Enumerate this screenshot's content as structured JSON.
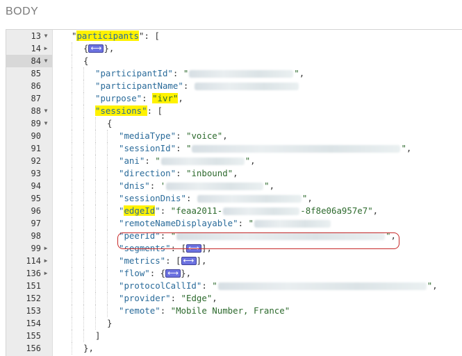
{
  "section_title": "BODY",
  "editor": {
    "lines": [
      {
        "n": "13",
        "fold": "down",
        "indent": 1,
        "parts": [
          {
            "t": "\"",
            "c": "p"
          },
          {
            "t": "participants",
            "c": "k",
            "hl": true
          },
          {
            "t": "\": [",
            "c": "p"
          }
        ]
      },
      {
        "n": "14",
        "fold": "right",
        "indent": 2,
        "parts": [
          {
            "t": "{",
            "c": "p"
          },
          {
            "w": true
          },
          {
            "t": "},",
            "c": "p"
          }
        ]
      },
      {
        "n": "84",
        "fold": "down",
        "indent": 2,
        "active": true,
        "parts": [
          {
            "t": "{",
            "c": "p"
          }
        ]
      },
      {
        "n": "85",
        "indent": 3,
        "parts": [
          {
            "t": "\"participantId\"",
            "c": "k"
          },
          {
            "t": ": ",
            "c": "p"
          },
          {
            "t": "\"",
            "c": "s"
          },
          {
            "b": 150
          },
          {
            "t": "\"",
            "c": "s"
          },
          {
            "t": ",",
            "c": "p"
          }
        ]
      },
      {
        "n": "86",
        "indent": 3,
        "parts": [
          {
            "t": "\"participantName\"",
            "c": "k"
          },
          {
            "t": ": ",
            "c": "p"
          },
          {
            "b": 150
          },
          {
            "t": "",
            "c": "s"
          }
        ]
      },
      {
        "n": "87",
        "indent": 3,
        "parts": [
          {
            "t": "\"purpose\"",
            "c": "k"
          },
          {
            "t": ": ",
            "c": "p"
          },
          {
            "t": "\"ivr\"",
            "c": "s",
            "hl": true
          },
          {
            "t": ",",
            "c": "p"
          }
        ]
      },
      {
        "n": "88",
        "fold": "down",
        "indent": 3,
        "parts": [
          {
            "t": "\"sessions\"",
            "c": "k",
            "hl": true
          },
          {
            "t": ": [",
            "c": "p"
          }
        ]
      },
      {
        "n": "89",
        "fold": "down",
        "indent": 4,
        "parts": [
          {
            "t": "{",
            "c": "p"
          }
        ]
      },
      {
        "n": "90",
        "indent": 5,
        "parts": [
          {
            "t": "\"mediaType\"",
            "c": "k"
          },
          {
            "t": ": ",
            "c": "p"
          },
          {
            "t": "\"voice\"",
            "c": "s"
          },
          {
            "t": ",",
            "c": "p"
          }
        ]
      },
      {
        "n": "91",
        "indent": 5,
        "parts": [
          {
            "t": "\"sessionId\"",
            "c": "k"
          },
          {
            "t": ": ",
            "c": "p"
          },
          {
            "t": "\"",
            "c": "s"
          },
          {
            "b": 300
          },
          {
            "t": "\"",
            "c": "s"
          },
          {
            "t": ",",
            "c": "p"
          }
        ]
      },
      {
        "n": "92",
        "indent": 5,
        "parts": [
          {
            "t": "\"ani\"",
            "c": "k"
          },
          {
            "t": ": ",
            "c": "p"
          },
          {
            "t": "\"",
            "c": "s"
          },
          {
            "b": 120
          },
          {
            "t": "\"",
            "c": "s"
          },
          {
            "t": ",",
            "c": "p"
          }
        ]
      },
      {
        "n": "93",
        "indent": 5,
        "parts": [
          {
            "t": "\"direction\"",
            "c": "k"
          },
          {
            "t": ": ",
            "c": "p"
          },
          {
            "t": "\"inbound\"",
            "c": "s"
          },
          {
            "t": ",",
            "c": "p"
          }
        ]
      },
      {
        "n": "94",
        "indent": 5,
        "parts": [
          {
            "t": "\"dnis\"",
            "c": "k"
          },
          {
            "t": ": ",
            "c": "p"
          },
          {
            "t": "'",
            "c": "s"
          },
          {
            "b": 140
          },
          {
            "t": "\"",
            "c": "s"
          },
          {
            "t": ",",
            "c": "p"
          }
        ]
      },
      {
        "n": "95",
        "indent": 5,
        "parts": [
          {
            "t": "\"sessionDnis\"",
            "c": "k"
          },
          {
            "t": ": ",
            "c": "p"
          },
          {
            "b": 150
          },
          {
            "t": "\"",
            "c": "s"
          },
          {
            "t": ",",
            "c": "p"
          }
        ]
      },
      {
        "n": "96",
        "indent": 5,
        "parts": [
          {
            "t": "\"",
            "c": "k"
          },
          {
            "t": "edgeId",
            "c": "k",
            "hl": true
          },
          {
            "t": "\"",
            "c": "k"
          },
          {
            "t": ": ",
            "c": "p"
          },
          {
            "t": "\"feaa2011-",
            "c": "s"
          },
          {
            "b": 110
          },
          {
            "t": "-8f8e06a957e7\"",
            "c": "s"
          },
          {
            "t": ",",
            "c": "p"
          }
        ]
      },
      {
        "n": "97",
        "indent": 5,
        "parts": [
          {
            "t": "\"remoteNameDisplayable\"",
            "c": "k"
          },
          {
            "t": ": ",
            "c": "p"
          },
          {
            "t": "\"",
            "c": "s"
          },
          {
            "b": 110
          }
        ]
      },
      {
        "n": "98",
        "indent": 5,
        "parts": [
          {
            "t": "\"peerId\"",
            "c": "k"
          },
          {
            "t": ": ",
            "c": "p"
          },
          {
            "t": "\"",
            "c": "s"
          },
          {
            "b": 300
          },
          {
            "t": "\"",
            "c": "s"
          },
          {
            "t": ",",
            "c": "p"
          }
        ]
      },
      {
        "n": "99",
        "fold": "right",
        "indent": 5,
        "parts": [
          {
            "t": "\"segments\"",
            "c": "k"
          },
          {
            "t": ": [",
            "c": "p"
          },
          {
            "w": true
          },
          {
            "t": "],",
            "c": "p"
          }
        ]
      },
      {
        "n": "114",
        "fold": "right",
        "indent": 5,
        "parts": [
          {
            "t": "\"metrics\"",
            "c": "k"
          },
          {
            "t": ": [",
            "c": "p"
          },
          {
            "w": true
          },
          {
            "t": "],",
            "c": "p"
          }
        ]
      },
      {
        "n": "136",
        "fold": "right",
        "indent": 5,
        "parts": [
          {
            "t": "\"flow\"",
            "c": "k"
          },
          {
            "t": ": {",
            "c": "p"
          },
          {
            "w": true
          },
          {
            "t": "},",
            "c": "p"
          }
        ]
      },
      {
        "n": "151",
        "indent": 5,
        "parts": [
          {
            "t": "\"protocolCallId\"",
            "c": "k"
          },
          {
            "t": ": ",
            "c": "p"
          },
          {
            "t": "\"",
            "c": "s"
          },
          {
            "b": 300
          },
          {
            "t": "\"",
            "c": "s"
          },
          {
            "t": ",",
            "c": "p"
          }
        ]
      },
      {
        "n": "152",
        "indent": 5,
        "parts": [
          {
            "t": "\"provider\"",
            "c": "k"
          },
          {
            "t": ": ",
            "c": "p"
          },
          {
            "t": "\"Edge\"",
            "c": "s"
          },
          {
            "t": ",",
            "c": "p"
          }
        ]
      },
      {
        "n": "153",
        "indent": 5,
        "parts": [
          {
            "t": "\"remote\"",
            "c": "k"
          },
          {
            "t": ": ",
            "c": "p"
          },
          {
            "t": "\"Mobile Number, France\"",
            "c": "s"
          }
        ]
      },
      {
        "n": "154",
        "indent": 4,
        "parts": [
          {
            "t": "}",
            "c": "p"
          }
        ]
      },
      {
        "n": "155",
        "indent": 3,
        "parts": [
          {
            "t": "]",
            "c": "p"
          }
        ]
      },
      {
        "n": "156",
        "indent": 2,
        "parts": [
          {
            "t": "},",
            "c": "p"
          }
        ]
      }
    ]
  }
}
